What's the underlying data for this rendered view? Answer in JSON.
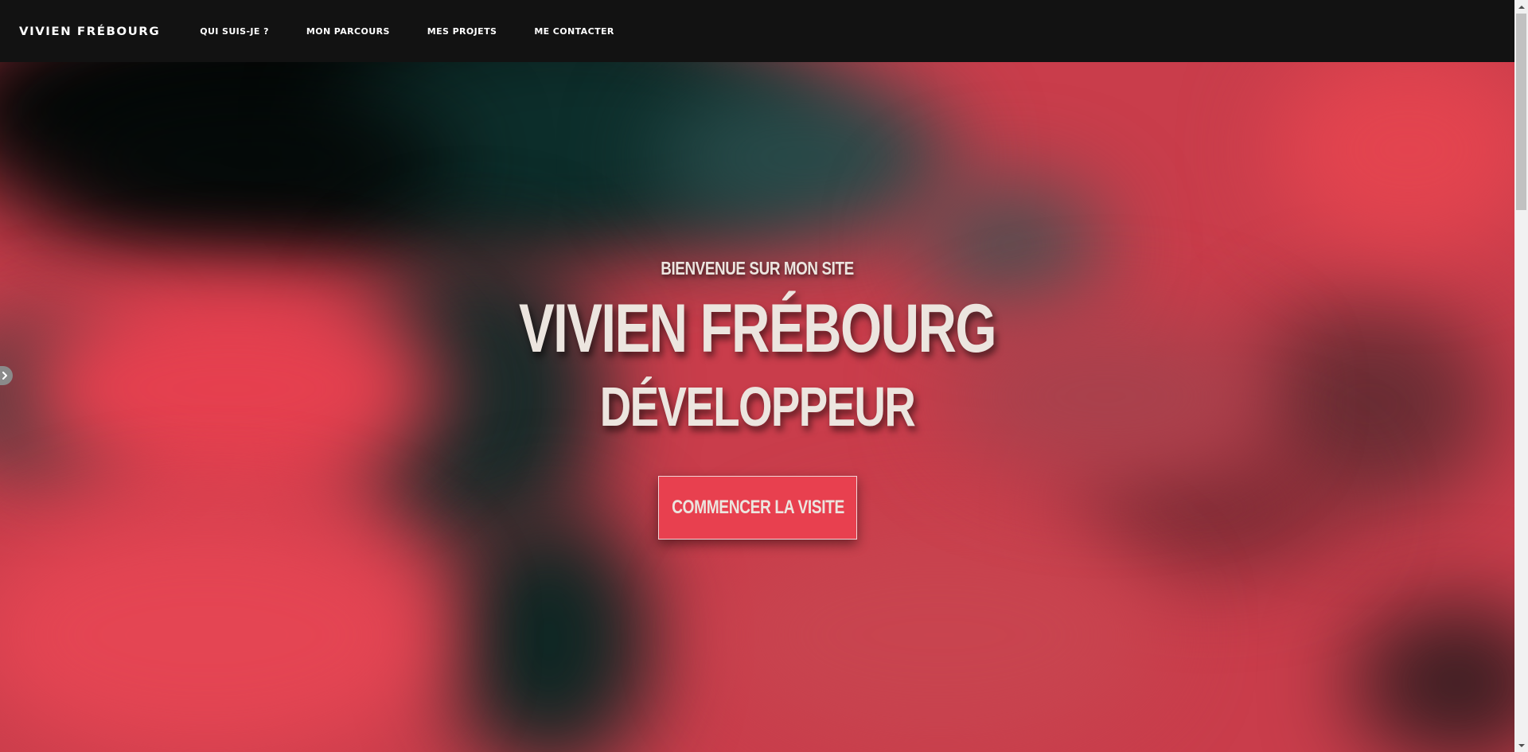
{
  "header": {
    "logo": "VIVIEN FRÉBOURG",
    "nav": [
      {
        "label": "QUI SUIS-JE ?"
      },
      {
        "label": "MON PARCOURS"
      },
      {
        "label": "MES PROJETS"
      },
      {
        "label": "ME CONTACTER"
      }
    ]
  },
  "hero": {
    "welcome": "BIENVENUE SUR MON SITE",
    "name": "VIVIEN FRÉBOURG",
    "role": "DÉVELOPPEUR",
    "cta_label": "COMMENCER LA VISITE"
  },
  "colors": {
    "header_bg": "#121212",
    "hero_red": "#e8404f",
    "hero_dark_teal": "#0c2b28",
    "text_cream": "#ece5df"
  },
  "icons": {
    "side_toggle": "chevron-right-icon",
    "scroll_up": "scroll-up-arrow-icon",
    "scroll_down": "scroll-down-arrow-icon"
  }
}
